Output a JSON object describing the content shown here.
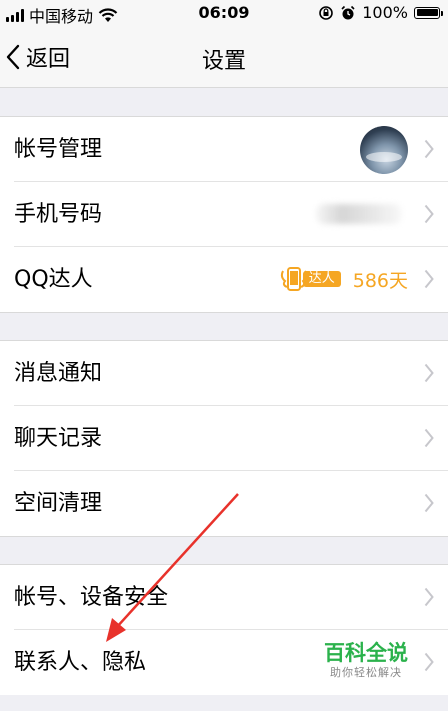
{
  "status_bar": {
    "carrier": "中国移动",
    "time": "06:09",
    "battery": "100%",
    "battery_level": 1.0
  },
  "nav": {
    "back_label": "返回",
    "title": "设置"
  },
  "groups": [
    {
      "items": [
        {
          "label": "帐号管理"
        },
        {
          "label": "手机号码"
        },
        {
          "label": "QQ达人",
          "badge_label": "达人",
          "badge_value": "586天"
        }
      ]
    },
    {
      "items": [
        {
          "label": "消息通知"
        },
        {
          "label": "聊天记录"
        },
        {
          "label": "空间清理"
        }
      ]
    },
    {
      "items": [
        {
          "label": "帐号、设备安全"
        },
        {
          "label": "联系人、隐私"
        }
      ]
    }
  ],
  "watermark": {
    "main": "百科全说",
    "sub": "助你轻松解决"
  },
  "colors": {
    "accent_orange": "#f5a623",
    "watermark_green": "#2bb24c",
    "annotation_red": "#e8322b",
    "background": "#efeff4"
  },
  "icons": [
    "signal-icon",
    "wifi-icon",
    "rotation-lock-icon",
    "alarm-icon",
    "battery-icon",
    "chevron-left-icon",
    "chevron-right-icon",
    "qq-expert-icon",
    "avatar"
  ]
}
